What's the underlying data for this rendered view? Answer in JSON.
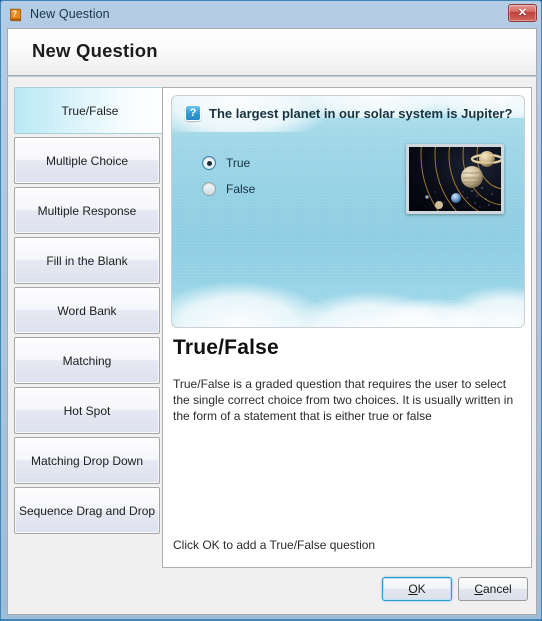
{
  "window": {
    "title": "New Question",
    "icon": "book-question-icon",
    "close_label": "✕",
    "header_title": "New Question"
  },
  "tabs": [
    {
      "label": "True/False",
      "name": "tab-true-false",
      "selected": true
    },
    {
      "label": "Multiple Choice",
      "name": "tab-multiple-choice",
      "selected": false
    },
    {
      "label": "Multiple Response",
      "name": "tab-multiple-response",
      "selected": false
    },
    {
      "label": "Fill in the Blank",
      "name": "tab-fill-in-the-blank",
      "selected": false
    },
    {
      "label": "Word Bank",
      "name": "tab-word-bank",
      "selected": false
    },
    {
      "label": "Matching",
      "name": "tab-matching",
      "selected": false
    },
    {
      "label": "Hot Spot",
      "name": "tab-hot-spot",
      "selected": false
    },
    {
      "label": "Matching Drop Down",
      "name": "tab-matching-drop-down",
      "selected": false
    },
    {
      "label": "Sequence Drag and Drop",
      "name": "tab-sequence-drag-and-drop",
      "selected": false
    }
  ],
  "preview": {
    "question_icon": "?",
    "question_text": "The largest planet in our solar system is Jupiter?",
    "choices": [
      {
        "label": "True",
        "checked": true
      },
      {
        "label": "False",
        "checked": false
      }
    ],
    "image_alt": "solar-system-planets-image"
  },
  "description": {
    "title": "True/False",
    "body": "True/False is a graded question that requires the user to select the single correct choice from two choices. It is usually written in the form of a statement that is either true or false"
  },
  "hint": "Click OK to add a True/False question",
  "footer": {
    "ok_prefix": "",
    "ok_mnemonic": "O",
    "ok_suffix": "K",
    "cancel_prefix": "",
    "cancel_mnemonic": "C",
    "cancel_suffix": "ancel"
  },
  "colors": {
    "title_bar": "#a9c5de",
    "frame_border": "#3f87b8",
    "sky": "#92d0e4",
    "accent_blue": "#2d9ad6",
    "selected_tab": "#b8e9f5",
    "close_red": "#bd413a"
  }
}
